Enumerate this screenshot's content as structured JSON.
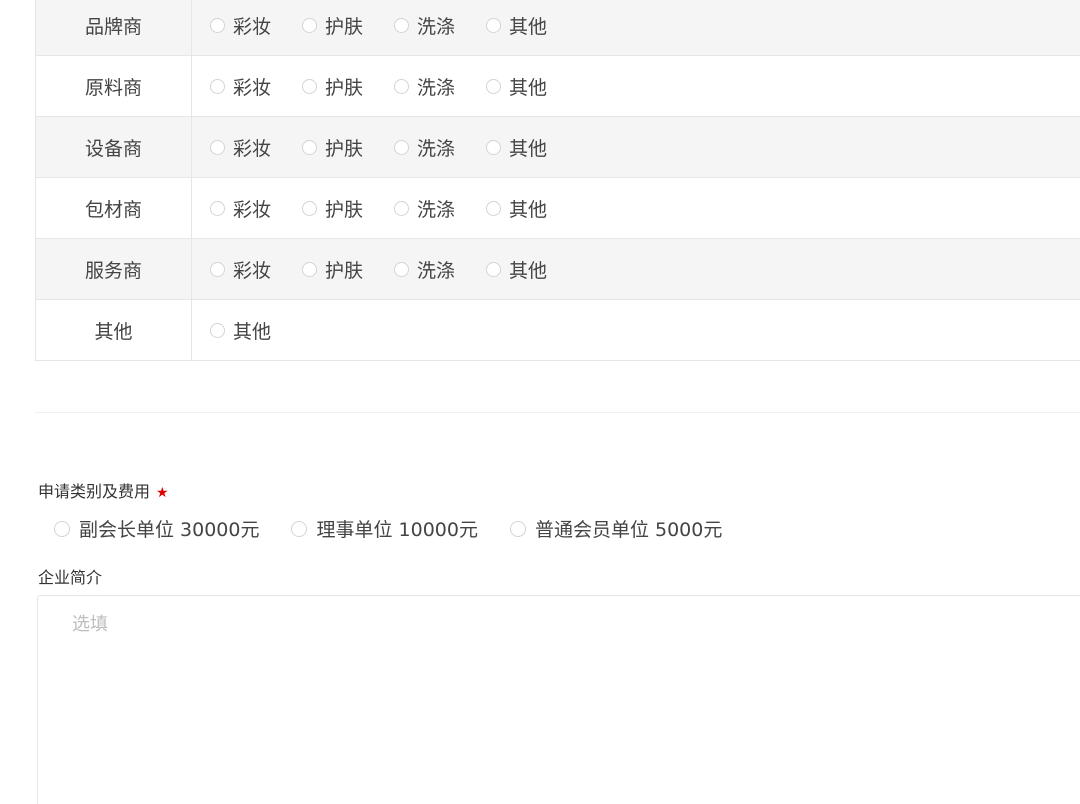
{
  "categories": [
    {
      "label": "品牌商",
      "options": [
        "彩妆",
        "护肤",
        "洗涤",
        "其他"
      ]
    },
    {
      "label": "原料商",
      "options": [
        "彩妆",
        "护肤",
        "洗涤",
        "其他"
      ]
    },
    {
      "label": "设备商",
      "options": [
        "彩妆",
        "护肤",
        "洗涤",
        "其他"
      ]
    },
    {
      "label": "包材商",
      "options": [
        "彩妆",
        "护肤",
        "洗涤",
        "其他"
      ]
    },
    {
      "label": "服务商",
      "options": [
        "彩妆",
        "护肤",
        "洗涤",
        "其他"
      ]
    },
    {
      "label": "其他",
      "options": [
        "其他"
      ]
    }
  ],
  "application": {
    "label": "申请类别及费用",
    "required_mark": "★",
    "options": [
      "副会长单位 30000元",
      "理事单位 10000元",
      "普通会员单位 5000元"
    ]
  },
  "intro": {
    "label": "企业简介",
    "placeholder": "选填",
    "value": ""
  },
  "colors": {
    "row_shaded": "#f5f5f5",
    "border": "#e6e6e6",
    "required": "#e00000",
    "placeholder": "#bdbdbd"
  }
}
